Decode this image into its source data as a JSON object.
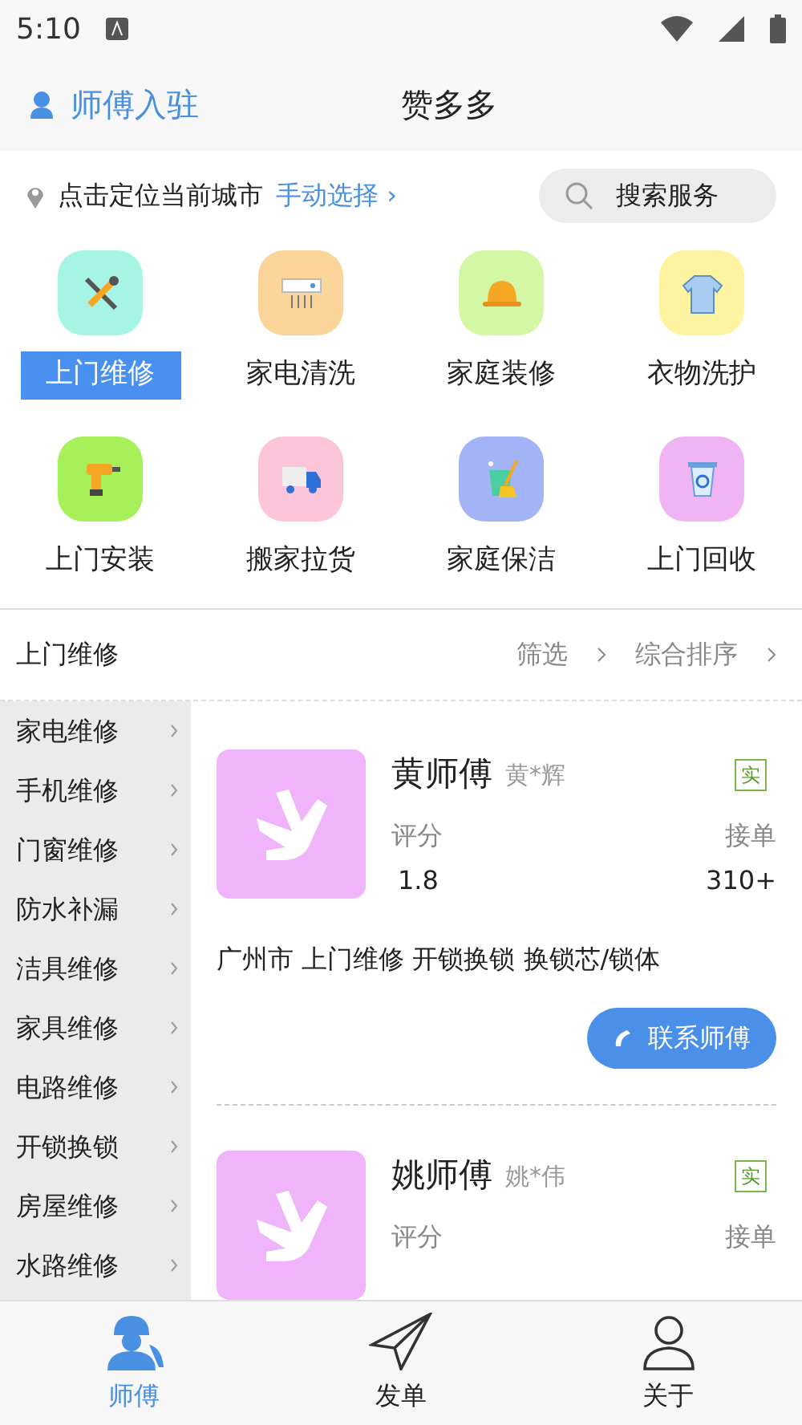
{
  "status_bar": {
    "time": "5:10"
  },
  "header": {
    "join_link": "师傅入驻",
    "title": "赞多多"
  },
  "location": {
    "prompt": "点击定位当前城市",
    "manual": "手动选择 ›",
    "search": "搜索服务"
  },
  "categories": [
    {
      "label": "上门维修",
      "selected": true,
      "color": "#a6f5e4"
    },
    {
      "label": "家电清洗",
      "selected": false,
      "color": "#fbd49a"
    },
    {
      "label": "家庭装修",
      "selected": false,
      "color": "#d4f7a6"
    },
    {
      "label": "衣物洗护",
      "selected": false,
      "color": "#fdf3a0"
    },
    {
      "label": "上门安装",
      "selected": false,
      "color": "#a6f05a"
    },
    {
      "label": "搬家拉货",
      "selected": false,
      "color": "#fbc4d8"
    },
    {
      "label": "家庭保洁",
      "selected": false,
      "color": "#a2b4f5"
    },
    {
      "label": "上门回收",
      "selected": false,
      "color": "#f0b4f5"
    }
  ],
  "section": {
    "title": "上门维修",
    "filter": "筛选",
    "sort": "综合排序"
  },
  "sidebar": {
    "items": [
      "家电维修",
      "手机维修",
      "门窗维修",
      "防水补漏",
      "洁具维修",
      "家具维修",
      "电路维修",
      "开锁换锁",
      "房屋维修",
      "水路维修"
    ]
  },
  "workers": [
    {
      "name": "黄师傅",
      "real_name": "黄*辉",
      "badge": "实",
      "rating_label": "评分",
      "rating": "1.8",
      "orders_label": "接单",
      "orders": "310+",
      "description": "广州市 上门维修 开锁换锁 换锁芯/锁体",
      "contact": "联系师傅"
    },
    {
      "name": "姚师傅",
      "real_name": "姚*伟",
      "badge": "实",
      "rating_label": "评分",
      "orders_label": "接单"
    }
  ],
  "tabs": [
    {
      "label": "师傅",
      "selected": true
    },
    {
      "label": "发单",
      "selected": false
    },
    {
      "label": "关于",
      "selected": false
    }
  ]
}
